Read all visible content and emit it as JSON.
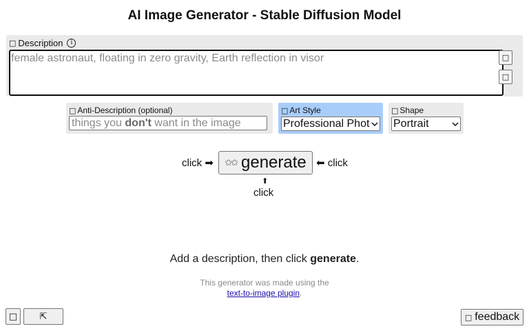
{
  "page": {
    "title": "AI Image Generator - Stable Diffusion Model"
  },
  "description": {
    "label": "Description",
    "label_icon": "box-glyph",
    "info_icon": "info-icon",
    "placeholder": "female astronaut, floating in zero gravity, Earth reflection in visor",
    "side_buttons": [
      {
        "glyph": "□"
      },
      {
        "glyph": "□"
      }
    ]
  },
  "anti_description": {
    "label": "Anti-Description (optional)",
    "placeholder_pre": "things you ",
    "placeholder_bold": "don't",
    "placeholder_post": " want in the image",
    "value": ""
  },
  "art_style": {
    "label": "Art Style",
    "selected": "Professional Photo",
    "highlight_color": "#a9cdfa"
  },
  "shape": {
    "label": "Shape",
    "selected": "Portrait"
  },
  "generate": {
    "label": "generate",
    "left_hint": "click ➡",
    "right_hint": "⬅ click",
    "up_arrow": "⬆",
    "below_hint": "click"
  },
  "hint": {
    "pre": "Add a description, then click ",
    "bold": "generate",
    "post": "."
  },
  "credit": {
    "line1": "This generator was made using the",
    "link": "text-to-image plugin",
    "post": "."
  },
  "footer": {
    "left_button_1": "□",
    "left_button_2": "⇱",
    "feedback_icon": "□",
    "feedback_label": "feedback"
  }
}
